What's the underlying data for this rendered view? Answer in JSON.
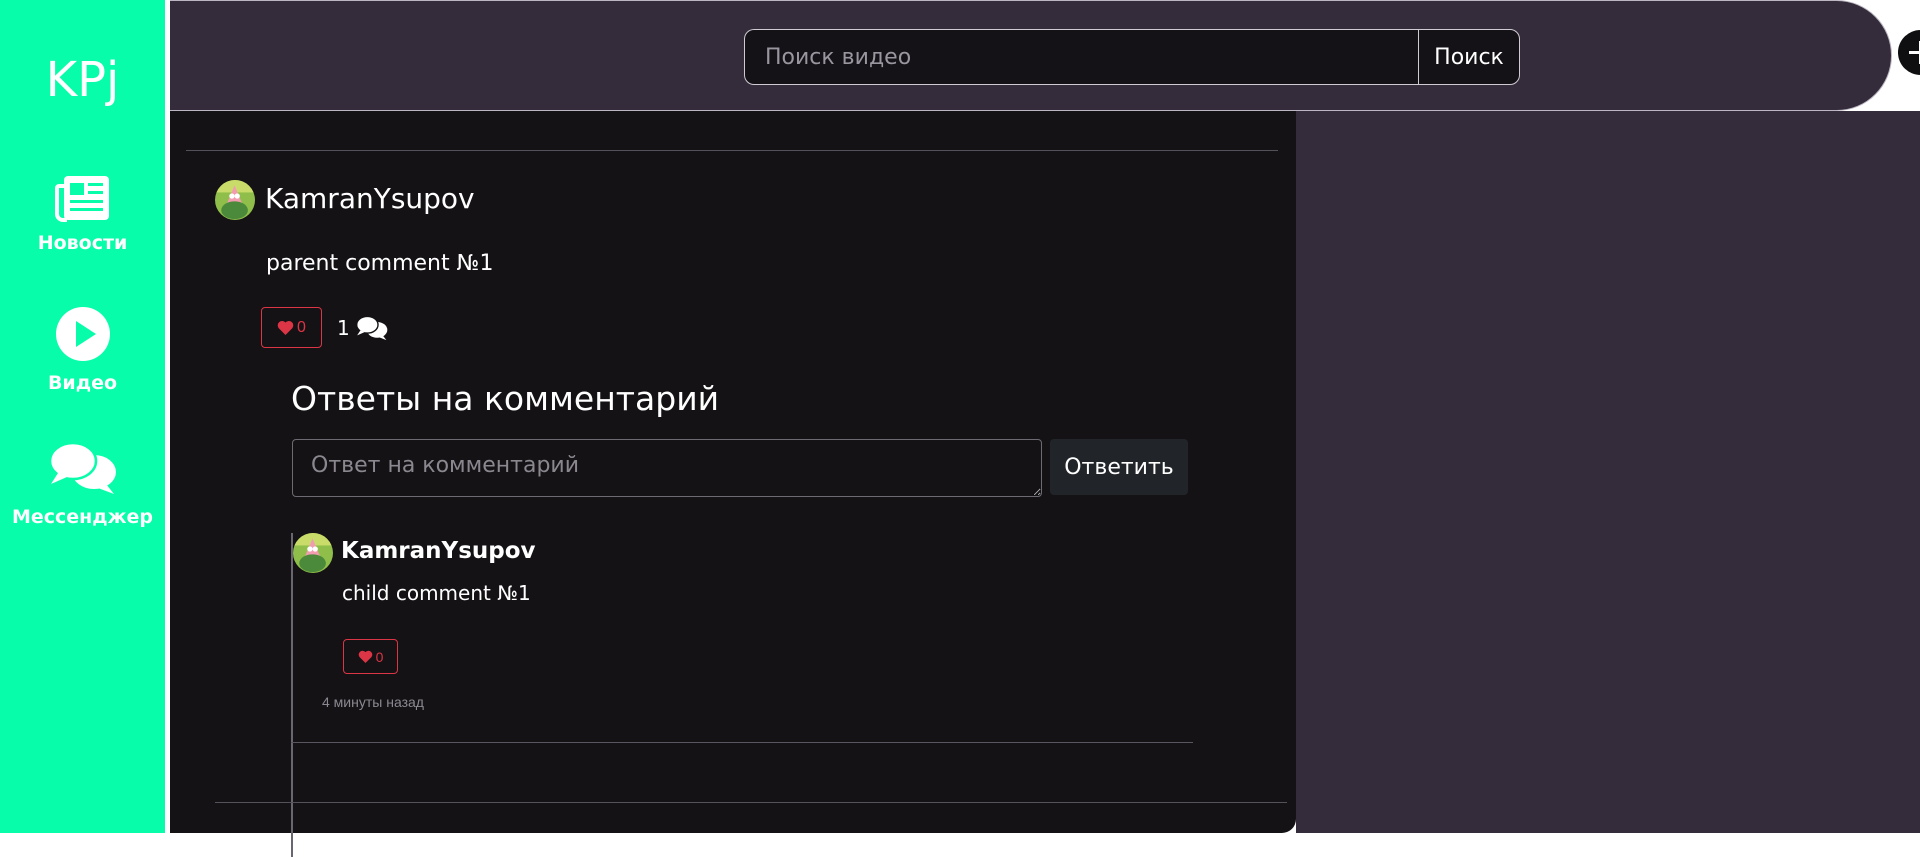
{
  "sidebar": {
    "logo": "KPj",
    "items": [
      {
        "label": "Новости",
        "icon": "newspaper-icon"
      },
      {
        "label": "Видео",
        "icon": "play-circle-icon"
      },
      {
        "label": "Мессенджер",
        "icon": "chat-bubbles-icon"
      }
    ]
  },
  "header": {
    "search": {
      "placeholder": "Поиск видео",
      "value": "",
      "button_label": "Поиск"
    },
    "add_icon": "plus-icon",
    "avatar_icon": "user-avatar"
  },
  "comment": {
    "author": "KamranYsupov",
    "text": "parent comment №1",
    "likes": "0",
    "replies_count": "1",
    "replies_section": {
      "title": "Ответы на комментарий",
      "input_placeholder": "Ответ на комментарий",
      "submit_label": "Ответить"
    },
    "children": [
      {
        "author": "KamranYsupov",
        "text": "child comment №1",
        "likes": "0",
        "time": "4 минуты назад"
      }
    ]
  },
  "colors": {
    "sidebar": "#08fdaa",
    "header": "#342c3b",
    "content": "#141215",
    "like": "#dc3545"
  }
}
